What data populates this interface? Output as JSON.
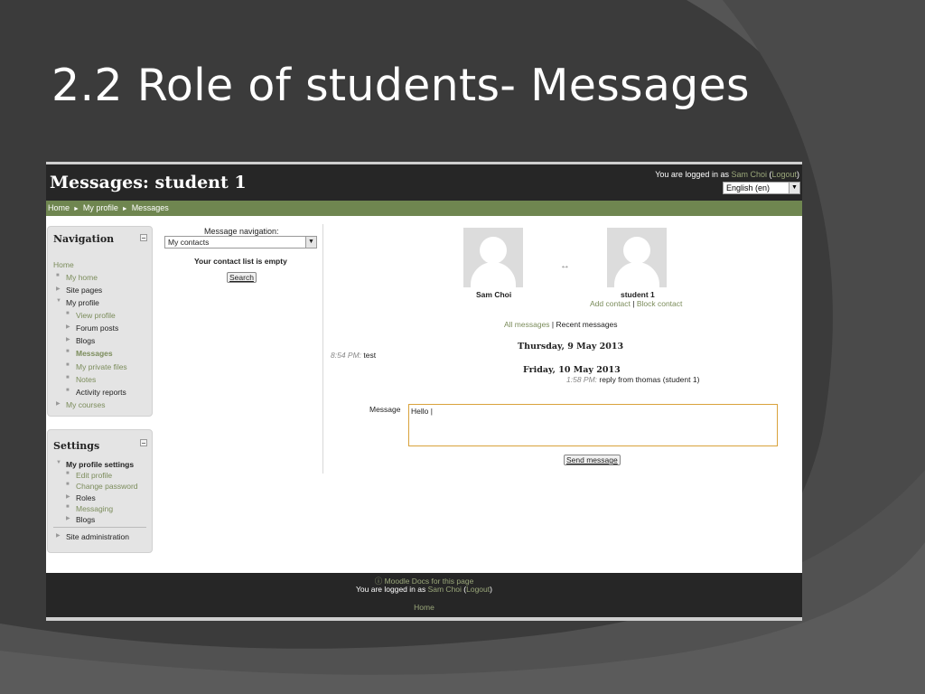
{
  "slide": {
    "title": "2.2 Role of students- Messages"
  },
  "header": {
    "title": "Messages: student 1",
    "login_prefix": "You are logged in as ",
    "user_name": "Sam Choi",
    "open_paren": " (",
    "logout": "Logout",
    "close_paren": ")",
    "language": "English (en)"
  },
  "breadcrumb": [
    "Home",
    "My profile",
    "Messages"
  ],
  "navigation": {
    "title": "Navigation",
    "items": [
      {
        "label": "Home",
        "style": "link"
      },
      {
        "label": "My home",
        "style": "link"
      },
      {
        "label": "Site pages",
        "style": "dark"
      },
      {
        "label": "My profile",
        "style": "dark"
      },
      {
        "label": "View profile",
        "style": "link"
      },
      {
        "label": "Forum posts",
        "style": "dark"
      },
      {
        "label": "Blogs",
        "style": "dark"
      },
      {
        "label": "Messages",
        "style": "active"
      },
      {
        "label": "My private files",
        "style": "link"
      },
      {
        "label": "Notes",
        "style": "link"
      },
      {
        "label": "Activity reports",
        "style": "dark"
      },
      {
        "label": "My courses",
        "style": "link"
      }
    ]
  },
  "settings": {
    "title": "Settings",
    "items": [
      {
        "label": "My profile settings",
        "style": "bold"
      },
      {
        "label": "Edit profile",
        "style": "link"
      },
      {
        "label": "Change password",
        "style": "link"
      },
      {
        "label": "Roles",
        "style": "dark"
      },
      {
        "label": "Messaging",
        "style": "link"
      },
      {
        "label": "Blogs",
        "style": "dark"
      },
      {
        "label": "Site administration",
        "style": "dark"
      }
    ]
  },
  "message_nav": {
    "label": "Message navigation:",
    "selected": "My contacts",
    "empty_text": "Your contact list is empty",
    "search_button": "Search"
  },
  "conversation": {
    "user_left": "Sam Choi",
    "user_right": "student 1",
    "arrow": "↔",
    "add_contact": "Add contact",
    "separator": " | ",
    "block_contact": "Block contact",
    "all_messages": "All messages",
    "recent_messages": "Recent messages",
    "days": [
      {
        "date": "Thursday, 9 May 2013",
        "time": "8:54 PM:",
        "text": " test"
      },
      {
        "date": "Friday, 10 May 2013",
        "time": "1:58 PM:",
        "text": " reply from thomas (student 1)"
      }
    ]
  },
  "compose": {
    "label": "Message",
    "value": "Hello |",
    "send_button": "Send message"
  },
  "footer": {
    "docs_icon": "info-icon",
    "docs_link": "Moodle Docs for this page",
    "login_prefix": "You are logged in as ",
    "user_name": "Sam Choi",
    "logout": "Logout",
    "home": "Home"
  },
  "colors": {
    "accent_green": "#6f8650",
    "link_green": "#7b8c5b",
    "header_bg": "#262626",
    "slide_bg": "#3b3b3b"
  }
}
